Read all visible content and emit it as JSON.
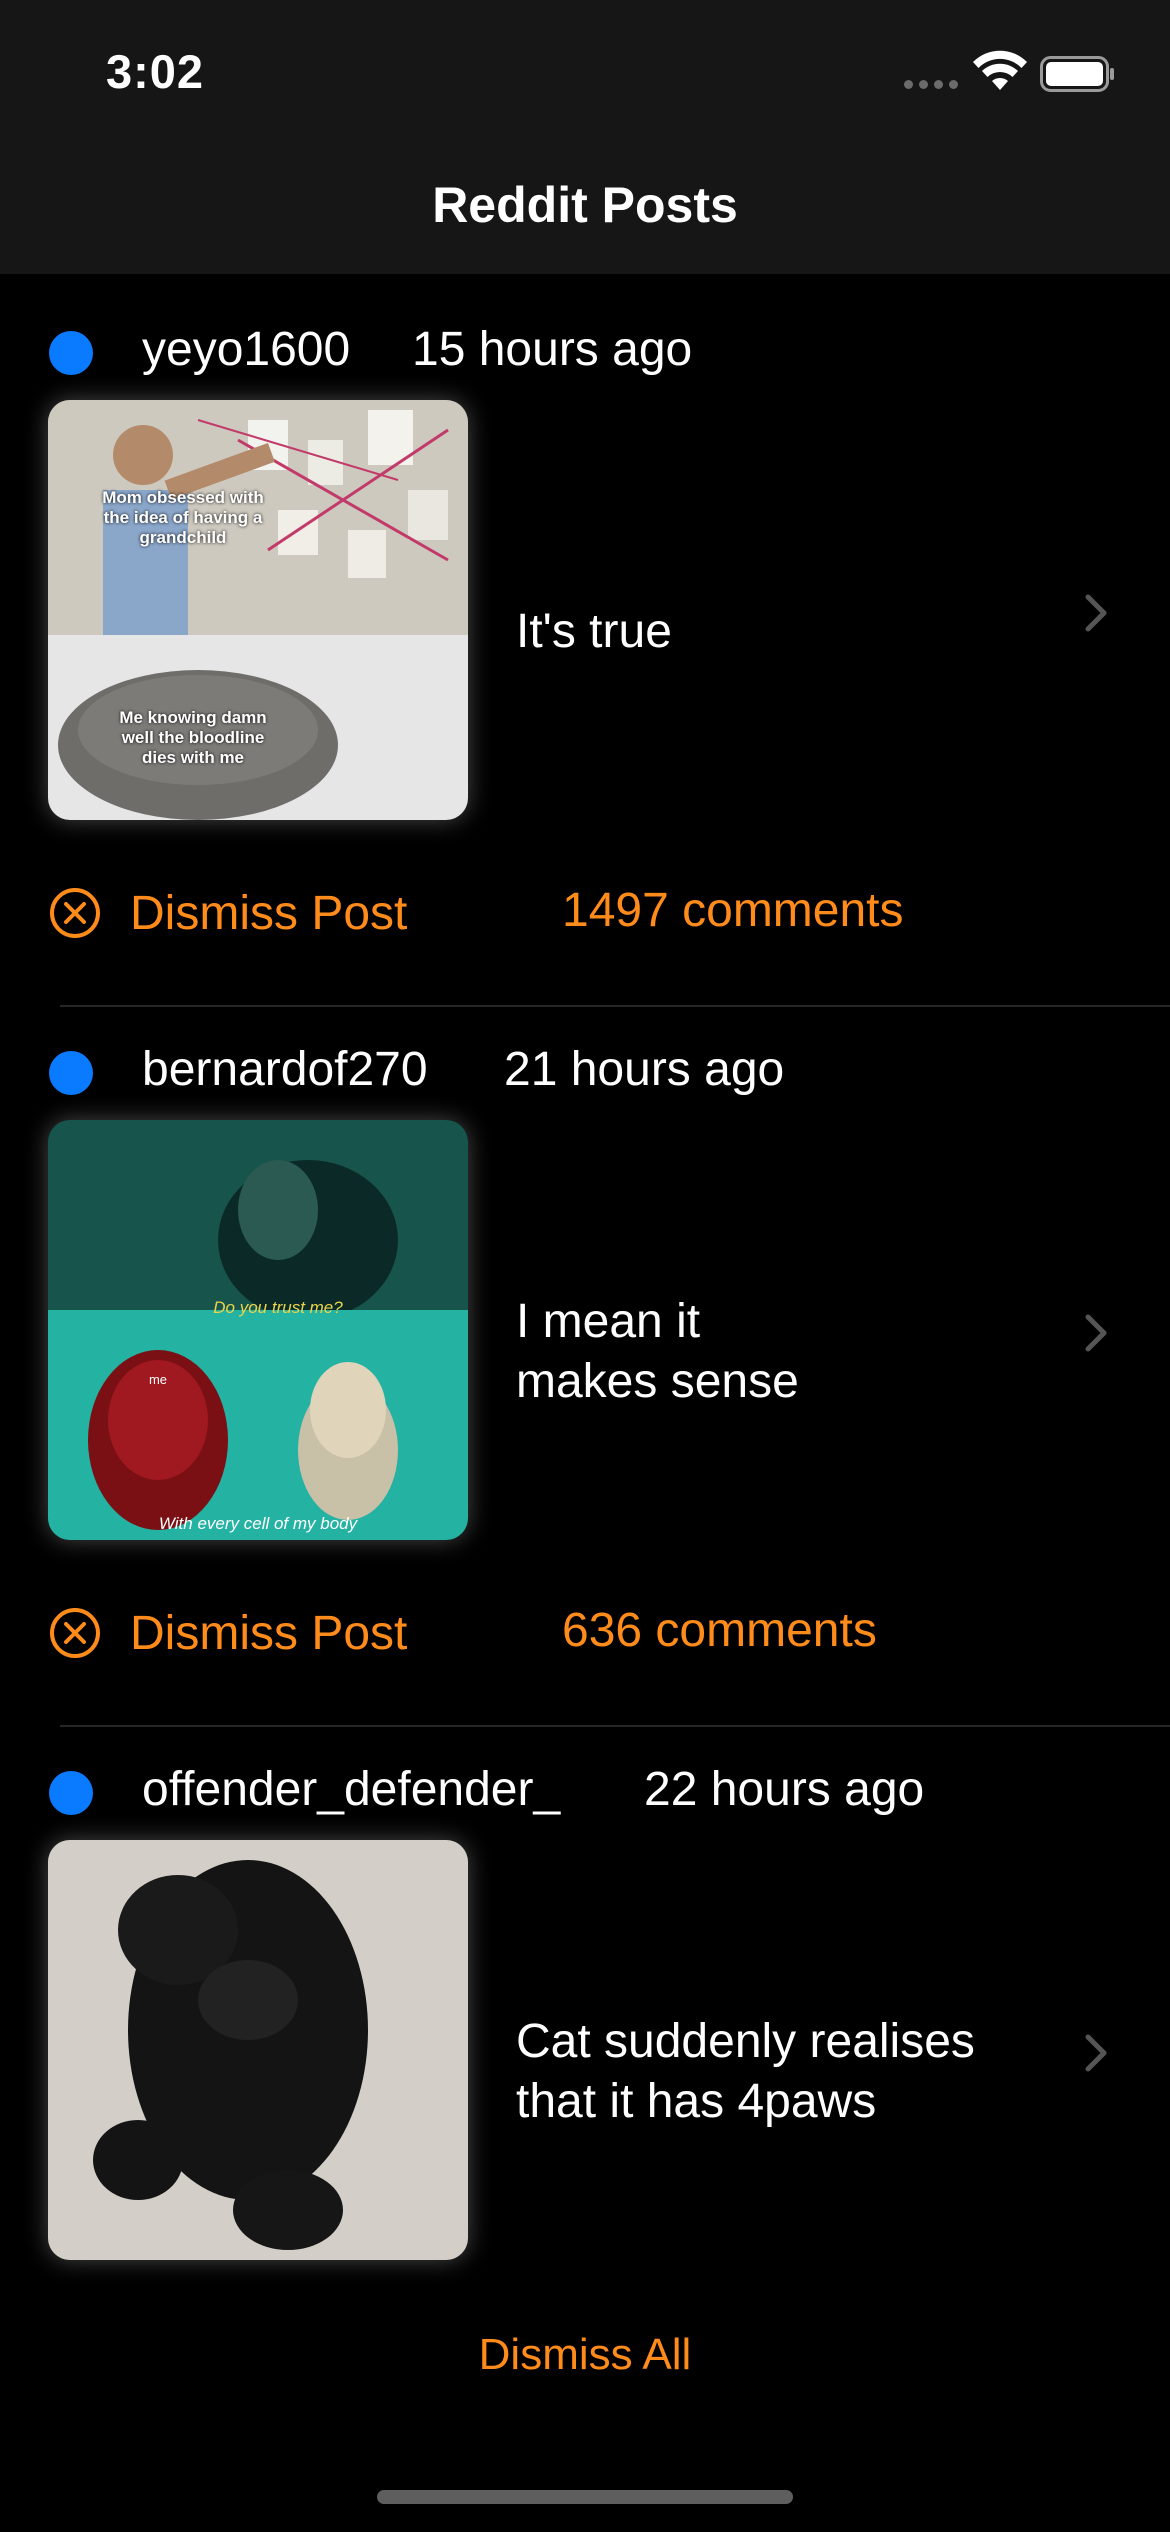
{
  "status_bar": {
    "time": "3:02",
    "icons": [
      "signal-icon",
      "wifi-icon",
      "battery-icon"
    ]
  },
  "nav": {
    "title": "Reddit Posts"
  },
  "posts": [
    {
      "author": "yeyo1600",
      "time_ago": "15 hours ago",
      "title": "It's true",
      "dismiss_label": "Dismiss Post",
      "comments": "1497 comments",
      "thumbnail_captions": [
        "Mom obsessed with the idea of having a grandchild",
        "Me knowing damn well the bloodline dies with me"
      ]
    },
    {
      "author": "bernardof270",
      "time_ago": "21 hours ago",
      "title": "I mean it\nmakes sense",
      "dismiss_label": "Dismiss Post",
      "comments": "636 comments",
      "thumbnail_captions": [
        "Do you trust me?",
        "me",
        "With every cell of my body"
      ]
    },
    {
      "author": "offender_defender_",
      "time_ago": "22 hours ago",
      "title": "Cat suddenly realises\nthat it has 4paws",
      "thumbnail_captions": []
    }
  ],
  "footer": {
    "dismiss_all": "Dismiss All"
  },
  "colors": {
    "accent": "#ff8c1a",
    "unread_dot": "#0a7aff",
    "background": "#000000",
    "nav_background": "#161616"
  }
}
